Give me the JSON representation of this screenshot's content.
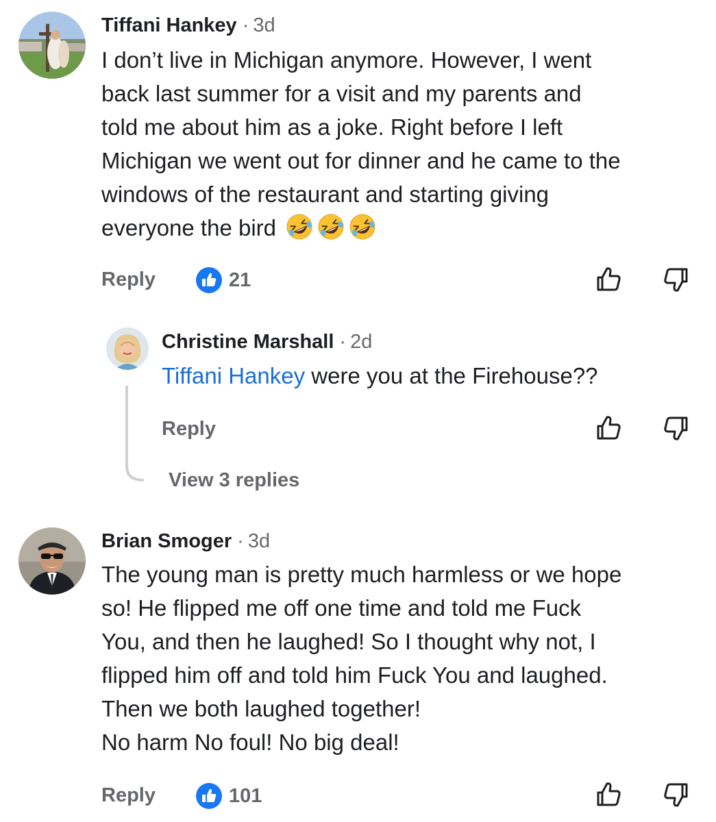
{
  "comments": [
    {
      "author": "Tiffani Hankey",
      "separator": "·",
      "time": "3d",
      "lines": [
        "I don’t live in Michigan anymore. However, I went",
        "back last summer for a visit and my parents and",
        "told me about him as a joke. Right before I left",
        "Michigan we went out for dinner and he came to the",
        "windows of the restaurant and starting giving",
        "everyone the bird"
      ],
      "trailing_emoji": [
        "rolling-on-floor-laughing-emoji",
        "rolling-on-floor-laughing-emoji",
        "rolling-on-floor-laughing-emoji"
      ],
      "reply_label": "Reply",
      "like_count": "21",
      "reply": {
        "author": "Christine Marshall",
        "separator": "·",
        "time": "2d",
        "mention": "Tiffani Hankey",
        "text": " were you at the Firehouse??",
        "reply_label": "Reply",
        "view_replies_label": "View 3 replies"
      }
    },
    {
      "author": "Brian Smoger",
      "separator": "·",
      "time": "3d",
      "lines": [
        "The young man is pretty much harmless or we hope",
        "so! He flipped me off one time and told me Fuck",
        "You, and then he laughed! So I thought why not, I",
        "flipped him off and told him Fuck You and laughed.",
        "Then we both laughed together!",
        "No harm No foul! No big deal!"
      ],
      "reply_label": "Reply",
      "like_count": "101"
    }
  ],
  "icons": {
    "like_badge": "like-thumb-badge-icon",
    "upvote": "thumbs-up-outline-icon",
    "downvote": "thumbs-down-outline-icon"
  },
  "colors": {
    "like_blue": "#1877f2",
    "mention_blue": "#1a6ed8",
    "secondary_text": "#65676b",
    "primary_text": "#1c1e21"
  }
}
